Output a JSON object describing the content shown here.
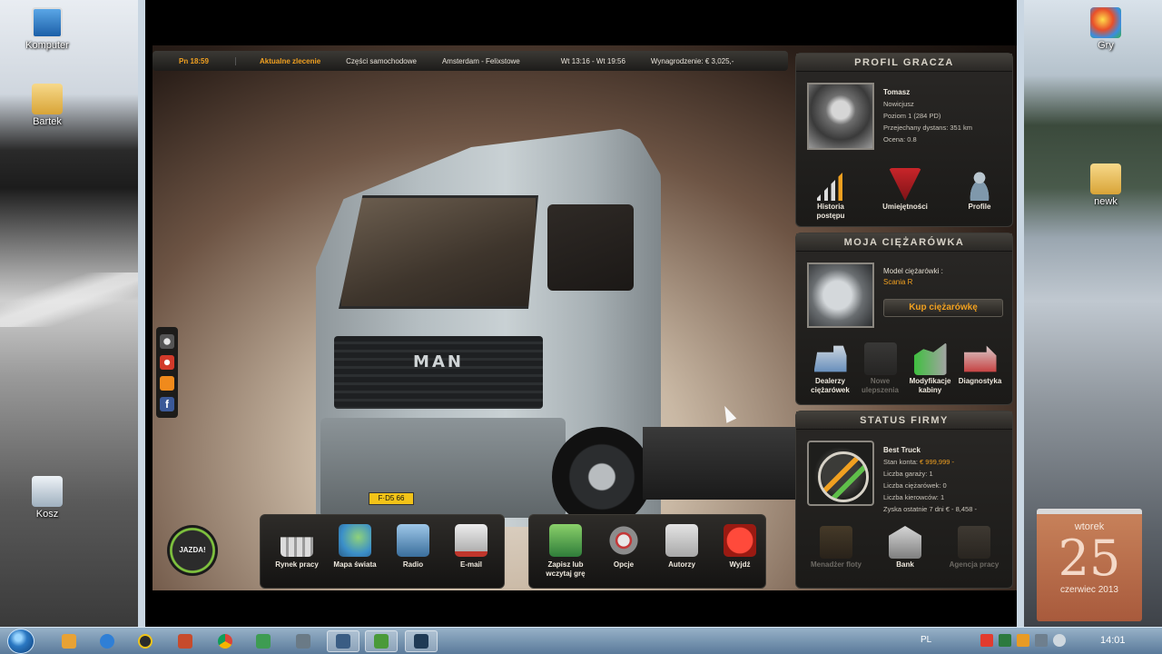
{
  "desktop": {
    "icons": [
      {
        "label": "Komputer"
      },
      {
        "label": "Bartek"
      },
      {
        "label": "Kosz"
      },
      {
        "label": "Gry"
      },
      {
        "label": "newk"
      }
    ]
  },
  "topbar": {
    "time": "Pn 18:59",
    "order_label": "Aktualne zlecenie",
    "cargo": "Części samochodowe",
    "route": "Amsterdam - Felixstowe",
    "window": "Wt 13:16 - Wt 19:56",
    "reward": "Wynagrodzenie: € 3,025,-"
  },
  "truck_view": {
    "logo": "MAN",
    "plate": "F·D5 66"
  },
  "profile": {
    "title": "PROFIL GRACZA",
    "name": "Tomasz",
    "rank": "Nowicjusz",
    "level": "Poziom 1 (284 PD)",
    "distance": "Przejechany dystans: 351 km",
    "rating": "Ocena: 0.8",
    "buttons": [
      {
        "label": "Historia postępu"
      },
      {
        "label": "Umiejętności"
      },
      {
        "label": "Profile"
      }
    ]
  },
  "my_truck": {
    "title": "MOJA CIĘŻARÓWKA",
    "model_label": "Model ciężarówki :",
    "model_value": "Scania R",
    "buy_label": "Kup ciężarówkę",
    "buttons": [
      {
        "label": "Dealerzy ciężarówek"
      },
      {
        "label": "Nowe ulepszenia"
      },
      {
        "label": "Modyfikacje kabiny"
      },
      {
        "label": "Diagnostyka"
      }
    ]
  },
  "company": {
    "title": "STATUS FIRMY",
    "name": "Best Truck",
    "balance_label": "Stan konta:",
    "balance_value": "€ 999,999 -",
    "garages": "Liczba garaży: 1",
    "trucks": "Liczba ciężarówek: 0",
    "drivers": "Liczba kierowców: 1",
    "profit": "Zyska ostatnie 7 dni € - 8,458 -",
    "buttons": [
      {
        "label": "Menadżer floty"
      },
      {
        "label": "Bank"
      },
      {
        "label": "Agencja pracy"
      }
    ]
  },
  "dock": {
    "jazda": "JAZDA!",
    "left": [
      {
        "label": "Rynek pracy"
      },
      {
        "label": "Mapa świata"
      },
      {
        "label": "Radio"
      },
      {
        "label": "E-mail"
      }
    ],
    "right": [
      {
        "label": "Zapisz lub wczytaj grę"
      },
      {
        "label": "Opcje"
      },
      {
        "label": "Autorzy"
      },
      {
        "label": "Wyjdź"
      }
    ]
  },
  "calendar": {
    "day": "wtorek",
    "date": "25",
    "month": "czerwiec 2013"
  },
  "taskbar": {
    "lang": "PL",
    "clock": "14:01"
  }
}
